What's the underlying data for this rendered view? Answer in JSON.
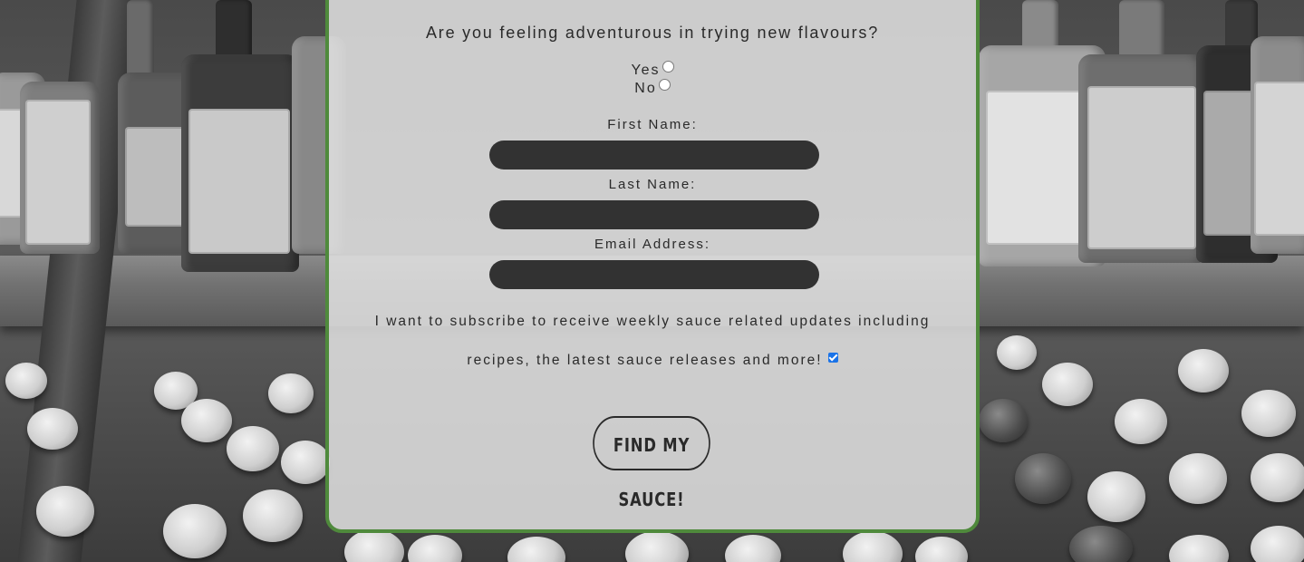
{
  "form": {
    "question": "Are you feeling adventurous in trying new flavours?",
    "radio_options": [
      {
        "label": "Yes",
        "selected": false
      },
      {
        "label": "No",
        "selected": false
      }
    ],
    "fields": {
      "first_name": {
        "label": "First Name:",
        "value": ""
      },
      "last_name": {
        "label": "Last Name:",
        "value": ""
      },
      "email": {
        "label": "Email Address:",
        "value": ""
      }
    },
    "subscribe": {
      "line1": "I want to subscribe to receive weekly sauce related updates including",
      "line2": "recipes, the latest sauce releases and more!",
      "checked": true
    },
    "submit_label": "FIND MY SAUCE!"
  },
  "colors": {
    "panel_border": "#4f8a3c",
    "input_background": "#323232",
    "checkbox_accent": "#1a73e8"
  },
  "icons": {
    "background": "hot-sauce-shelf-photo"
  }
}
